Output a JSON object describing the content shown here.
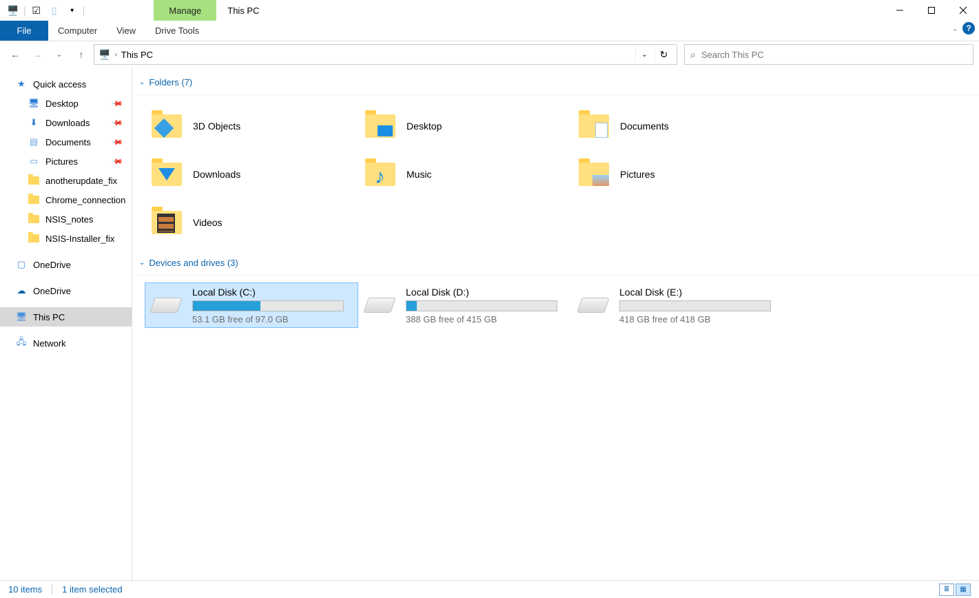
{
  "title": "This PC",
  "context_tab_header": "Manage",
  "ribbon": {
    "file": "File",
    "tabs": [
      "Computer",
      "View"
    ],
    "context_tabs": [
      "Drive Tools"
    ]
  },
  "address": {
    "crumbs": [
      "This PC"
    ]
  },
  "search": {
    "placeholder": "Search This PC"
  },
  "sidebar": {
    "quick_access": {
      "label": "Quick access",
      "items": [
        {
          "label": "Desktop",
          "pinned": true
        },
        {
          "label": "Downloads",
          "pinned": true
        },
        {
          "label": "Documents",
          "pinned": true
        },
        {
          "label": "Pictures",
          "pinned": true
        },
        {
          "label": "anotherupdate_fix",
          "pinned": false
        },
        {
          "label": "Chrome_connection",
          "pinned": false
        },
        {
          "label": "NSIS_notes",
          "pinned": false
        },
        {
          "label": "NSIS-Installer_fix",
          "pinned": false
        }
      ]
    },
    "onedrive_local": "OneDrive",
    "onedrive_cloud": "OneDrive",
    "this_pc": "This PC",
    "network": "Network"
  },
  "sections": {
    "folders": {
      "header": "Folders (7)",
      "items": [
        "3D Objects",
        "Desktop",
        "Documents",
        "Downloads",
        "Music",
        "Pictures",
        "Videos"
      ]
    },
    "drives": {
      "header": "Devices and drives (3)",
      "items": [
        {
          "name": "Local Disk (C:)",
          "free_text": "53.1 GB free of 97.0 GB",
          "used_pct": 45,
          "selected": true
        },
        {
          "name": "Local Disk (D:)",
          "free_text": "388 GB free of 415 GB",
          "used_pct": 7,
          "selected": false
        },
        {
          "name": "Local Disk (E:)",
          "free_text": "418 GB free of 418 GB",
          "used_pct": 0,
          "selected": false
        }
      ]
    }
  },
  "status": {
    "total": "10 items",
    "selection": "1 item selected"
  }
}
